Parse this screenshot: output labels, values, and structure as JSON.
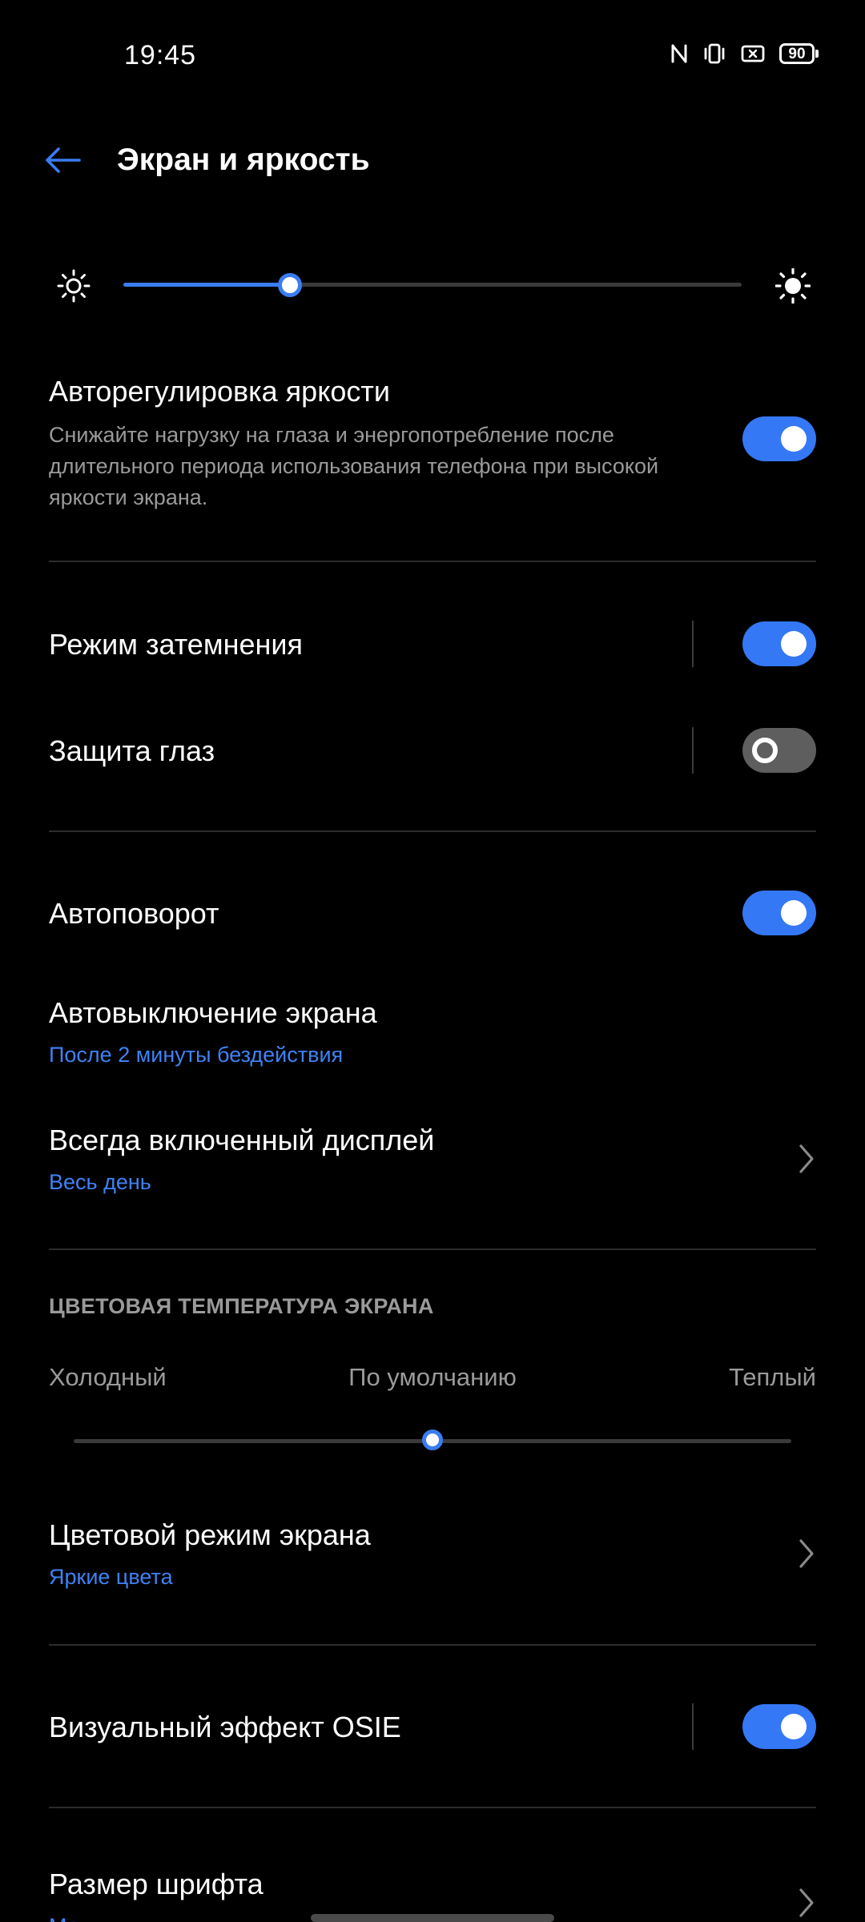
{
  "status_bar": {
    "time": "19:45",
    "battery_level": "90",
    "icons": [
      "nfc-icon",
      "vibrate-icon",
      "screen-record-icon",
      "battery-icon"
    ]
  },
  "header": {
    "title": "Экран и яркость",
    "back_icon": "arrow-left-icon"
  },
  "brightness": {
    "level_fraction": 0.27,
    "low_icon": "sun-small-icon",
    "high_icon": "sun-large-icon"
  },
  "settings": {
    "auto_brightness": {
      "title": "Авторегулировка яркости",
      "description": "Снижайте нагрузку на глаза и энергопотребление после длительного периода использования телефона при высокой яркости экрана.",
      "enabled": true
    },
    "dim_mode": {
      "title": "Режим затемнения",
      "enabled": true
    },
    "eye_protection": {
      "title": "Защита глаз",
      "enabled": false
    },
    "auto_rotate": {
      "title": "Автоповорот",
      "enabled": true
    },
    "screen_timeout": {
      "title": "Автовыключение экрана",
      "value": "После 2 минуты бездействия"
    },
    "always_on_display": {
      "title": "Всегда включенный дисплей",
      "value": "Весь день"
    },
    "color_temperature": {
      "section_title": "ЦВЕТОВАЯ ТЕМПЕРАТУРА ЭКРАНА",
      "cold_label": "Холодный",
      "default_label": "По умолчанию",
      "warm_label": "Теплый",
      "level_fraction": 0.5
    },
    "color_mode": {
      "title": "Цветовой режим экрана",
      "value": "Яркие цвета"
    },
    "osie_effect": {
      "title": "Визуальный эффект OSIE",
      "enabled": true
    },
    "font_size": {
      "title": "Размер шрифта",
      "value": "Мал"
    }
  },
  "colors": {
    "accent": "#3478f6",
    "background": "#000000",
    "secondary_text": "#9a9a9a"
  }
}
